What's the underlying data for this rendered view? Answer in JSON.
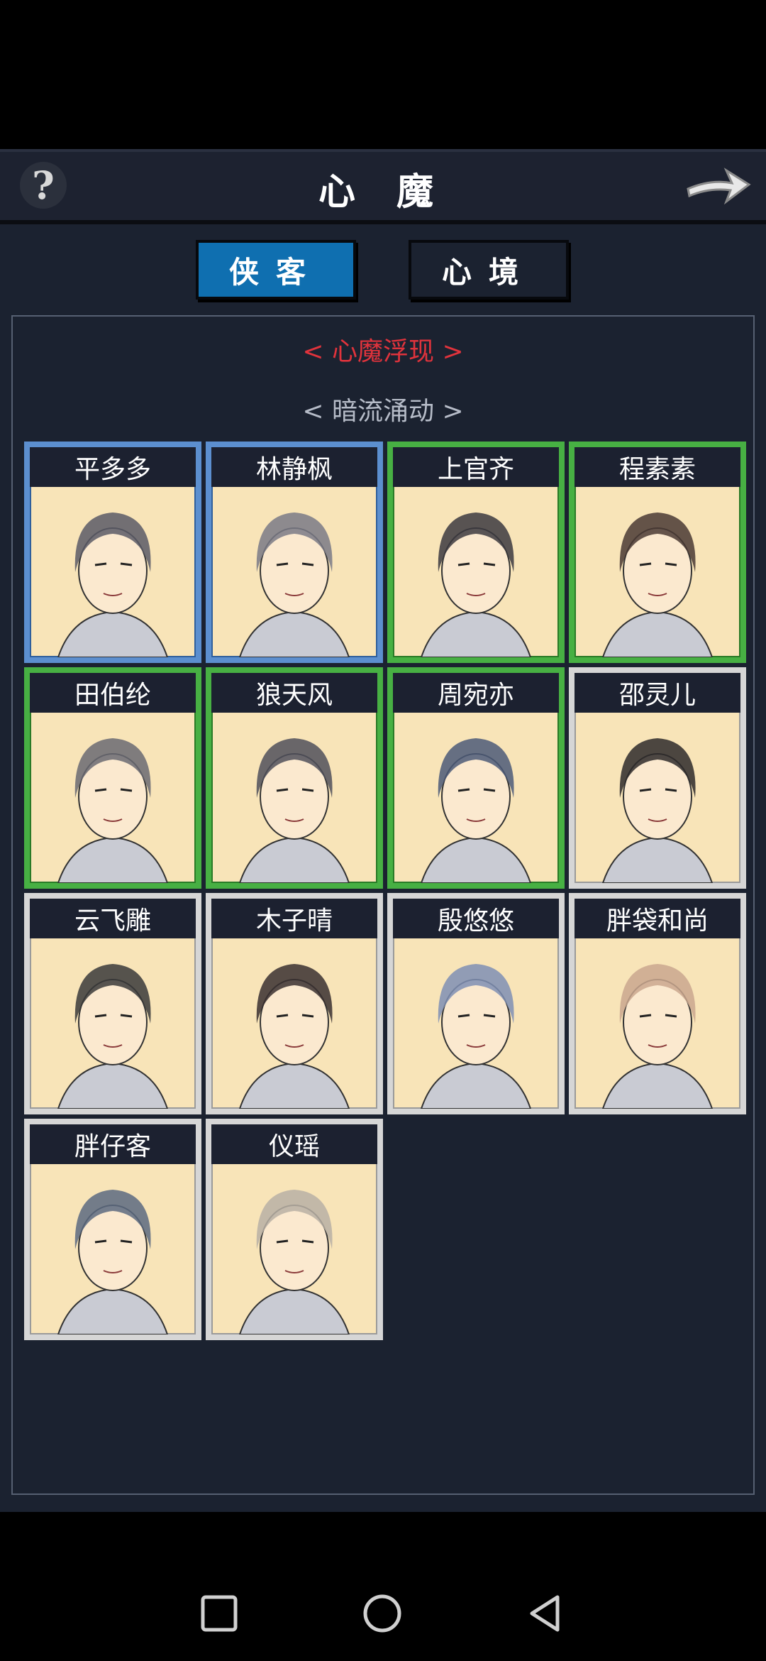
{
  "header": {
    "title": "心 魔",
    "help_icon": "question-mark-icon",
    "next_icon": "arrow-right-icon"
  },
  "tabs": [
    {
      "label": "侠客",
      "active": true
    },
    {
      "label": "心境",
      "active": false
    }
  ],
  "sections": {
    "active_title": "< 心魔浮现 >",
    "latent_title": "< 暗流涌动 >"
  },
  "characters": [
    {
      "name": "平多多",
      "rarity": "blue"
    },
    {
      "name": "林静枫",
      "rarity": "blue"
    },
    {
      "name": "上官齐",
      "rarity": "green"
    },
    {
      "name": "程素素",
      "rarity": "green"
    },
    {
      "name": "田伯纶",
      "rarity": "green"
    },
    {
      "name": "狼天风",
      "rarity": "green"
    },
    {
      "name": "周宛亦",
      "rarity": "green"
    },
    {
      "name": "邵灵儿",
      "rarity": "white"
    },
    {
      "name": "云飞雕",
      "rarity": "white"
    },
    {
      "name": "木子晴",
      "rarity": "white"
    },
    {
      "name": "殷悠悠",
      "rarity": "white"
    },
    {
      "name": "胖袋和尚",
      "rarity": "white"
    },
    {
      "name": "胖仔客",
      "rarity": "white"
    },
    {
      "name": "仪瑶",
      "rarity": "white"
    }
  ],
  "colors": {
    "rarity_blue": "#5c8fcf",
    "rarity_green": "#47b043",
    "rarity_white": "#d6d6d6",
    "active_tab": "#0f6fb0",
    "section_red": "#e0333c"
  },
  "navbar": {
    "recent_icon": "square-icon",
    "home_icon": "circle-icon",
    "back_icon": "triangle-back-icon"
  }
}
